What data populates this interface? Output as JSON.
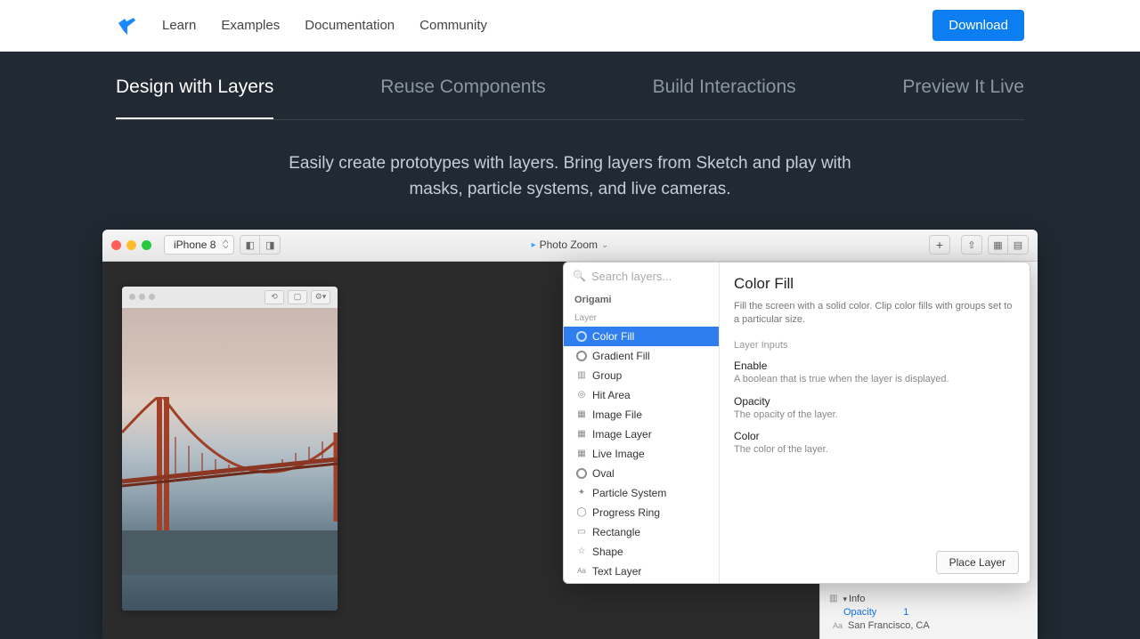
{
  "nav": {
    "links": [
      "Learn",
      "Examples",
      "Documentation",
      "Community"
    ],
    "download": "Download"
  },
  "tabs": {
    "items": [
      "Design with Layers",
      "Reuse Components",
      "Build Interactions",
      "Preview It Live"
    ],
    "active_index": 0
  },
  "subtitle": "Easily create prototypes with layers. Bring layers from Sketch and play with masks, particle systems, and live cameras.",
  "app": {
    "device": "iPhone 8",
    "doc_title": "Photo Zoom",
    "search_placeholder": "Search layers...",
    "popover": {
      "section": "Origami",
      "group_label": "Layer",
      "items": [
        {
          "icon": "circle",
          "label": "Color Fill",
          "selected": true
        },
        {
          "icon": "circle",
          "label": "Gradient Fill"
        },
        {
          "icon": "folder",
          "label": "Group"
        },
        {
          "icon": "target",
          "label": "Hit Area"
        },
        {
          "icon": "img",
          "label": "Image File"
        },
        {
          "icon": "img",
          "label": "Image Layer"
        },
        {
          "icon": "img",
          "label": "Live Image"
        },
        {
          "icon": "circle",
          "label": "Oval"
        },
        {
          "icon": "spark",
          "label": "Particle System"
        },
        {
          "icon": "ring",
          "label": "Progress Ring"
        },
        {
          "icon": "rect",
          "label": "Rectangle"
        },
        {
          "icon": "star",
          "label": "Shape"
        },
        {
          "icon": "aa",
          "label": "Text Layer"
        }
      ],
      "detail": {
        "title": "Color Fill",
        "desc": "Fill the screen with a solid color. Clip color fills with groups set to a particular size.",
        "inputs_label": "Layer Inputs",
        "props": [
          {
            "name": "Enable",
            "desc": "A boolean that is true when the layer is displayed."
          },
          {
            "name": "Opacity",
            "desc": "The opacity of the layer."
          },
          {
            "name": "Color",
            "desc": "The color of the layer."
          }
        ],
        "place_button": "Place Layer"
      }
    },
    "inspector": {
      "info_label": "Info",
      "opacity_label": "Opacity",
      "opacity_value": "1",
      "location_label": "San Francisco, CA"
    }
  }
}
